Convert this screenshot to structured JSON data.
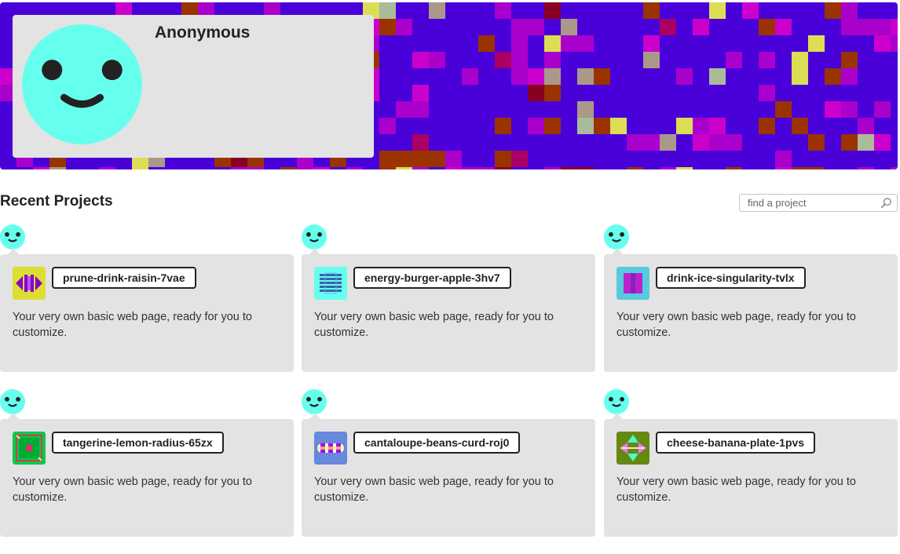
{
  "profile": {
    "name": "Anonymous",
    "avatar_color": "#66ffee",
    "avatar_icon": "smiley-face"
  },
  "banner": {
    "background_color": "#4a00d8",
    "palette": [
      "#4a00d8",
      "#aa00cc",
      "#9a3300",
      "#cc00cc",
      "#dddd55",
      "#aa9988",
      "#aabb99",
      "#880022",
      "#aa0066",
      "#5533aa"
    ]
  },
  "section": {
    "title": "Recent Projects"
  },
  "search": {
    "placeholder": "find a project"
  },
  "projects": [
    {
      "name": "prune-drink-raisin-7vae",
      "description": "Your very own basic web page, ready for you to customize.",
      "thumb_bg": "#dddd33",
      "thumb_fg": "#8800cc"
    },
    {
      "name": "energy-burger-apple-3hv7",
      "description": "Your very own basic web page, ready for you to customize.",
      "thumb_bg": "#66ffee",
      "thumb_fg": "#3366aa"
    },
    {
      "name": "drink-ice-singularity-tvlx",
      "description": "Your very own basic web page, ready for you to customize.",
      "thumb_bg": "#55ccdd",
      "thumb_fg": "#bb22cc"
    },
    {
      "name": "tangerine-lemon-radius-65zx",
      "description": "Your very own basic web page, ready for you to customize.",
      "thumb_bg": "#00cc44",
      "thumb_fg": "#dd3366"
    },
    {
      "name": "cantaloupe-beans-curd-roj0",
      "description": "Your very own basic web page, ready for you to customize.",
      "thumb_bg": "#6688dd",
      "thumb_fg": "#aa00ee"
    },
    {
      "name": "cheese-banana-plate-1pvs",
      "description": "Your very own basic web page, ready for you to customize.",
      "thumb_bg": "#668811",
      "thumb_fg": "#44ffcc"
    }
  ]
}
